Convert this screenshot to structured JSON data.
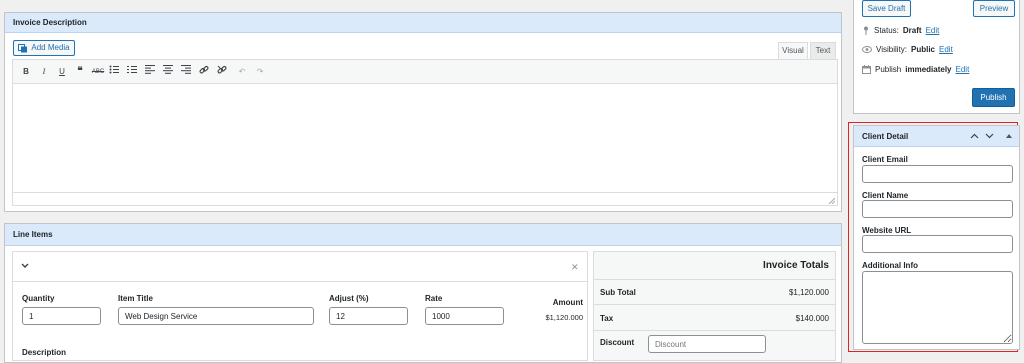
{
  "invoice_description": {
    "title": "Invoice Description",
    "add_media_label": "Add Media",
    "tab_visual": "Visual",
    "tab_text": "Text"
  },
  "line_items": {
    "title": "Line Items",
    "quantity_label": "Quantity",
    "quantity_value": "1",
    "item_title_label": "Item Title",
    "item_title_value": "Web Design Service",
    "adjust_label": "Adjust (%)",
    "adjust_value": "12",
    "rate_label": "Rate",
    "rate_value": "1000",
    "amount_label": "Amount",
    "amount_value": "$1,120.000",
    "description_label": "Description"
  },
  "invoice_totals": {
    "title": "Invoice Totals",
    "sub_total_label": "Sub Total",
    "sub_total_value": "$1,120.000",
    "tax_label": "Tax",
    "tax_value": "$140.000",
    "discount_label": "Discount",
    "discount_placeholder": "Discount"
  },
  "publish_box": {
    "save_draft_label": "Save Draft",
    "preview_label": "Preview",
    "status_label": "Status:",
    "status_value": "Draft",
    "visibility_label": "Visibility:",
    "visibility_value": "Public",
    "publish_label": "Publish",
    "publish_when": "immediately",
    "edit_label": "Edit",
    "publish_button_label": "Publish"
  },
  "client_detail": {
    "title": "Client Detail",
    "email_label": "Client Email",
    "name_label": "Client Name",
    "website_label": "Website URL",
    "additional_label": "Additional Info"
  },
  "colors": {
    "accent": "#2271b1",
    "header_bg": "#dbeafa",
    "highlight": "#e02424"
  }
}
